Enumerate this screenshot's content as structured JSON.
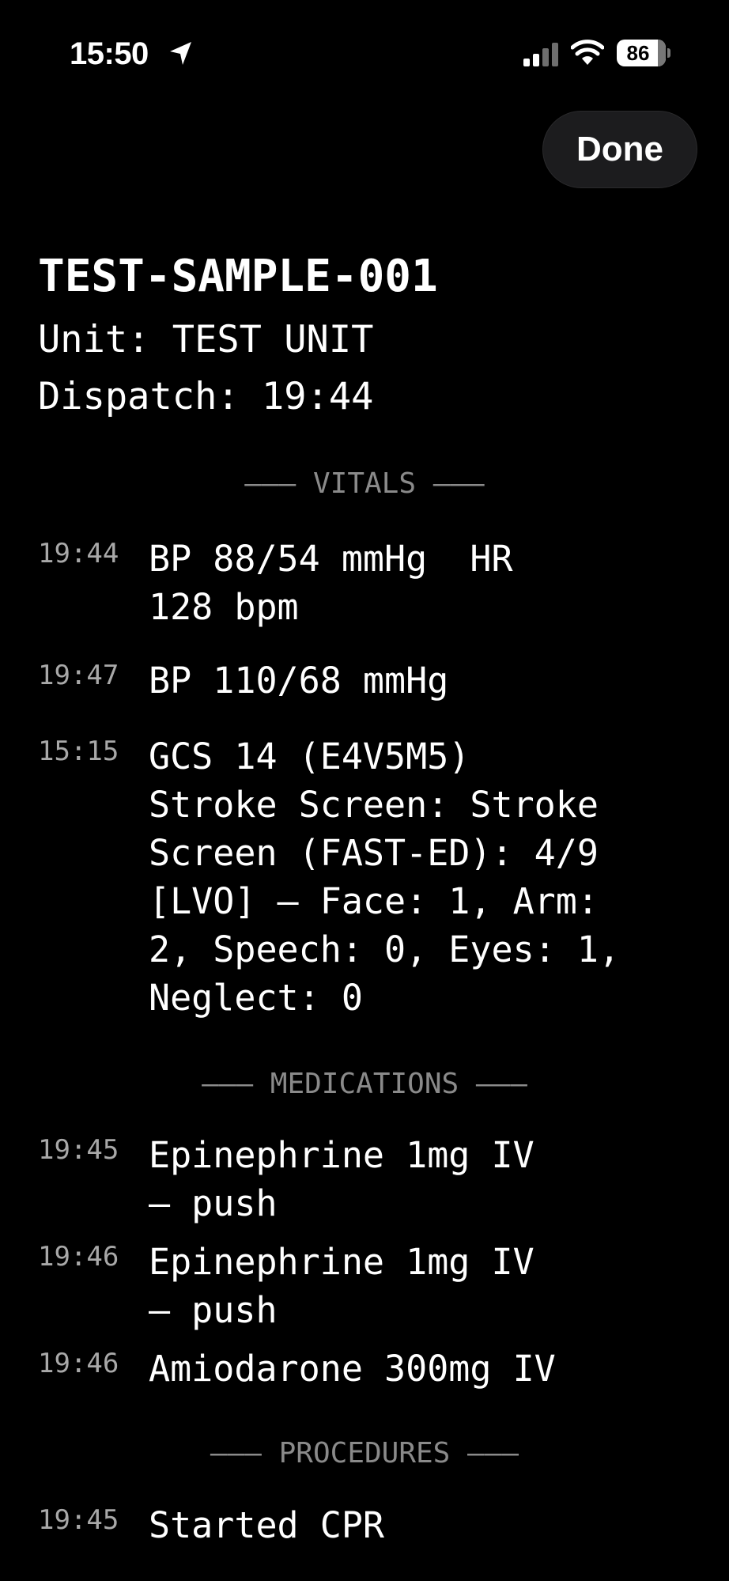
{
  "status_bar": {
    "time": "15:50",
    "battery": "86"
  },
  "header": {
    "done_label": "Done"
  },
  "record": {
    "id": "TEST-SAMPLE-001",
    "unit": "Unit: TEST UNIT",
    "dispatch": "Dispatch: 19:44"
  },
  "sections": {
    "vitals": "——— VITALS ———",
    "medications": "——— MEDICATIONS ———",
    "procedures": "——— PROCEDURES ———"
  },
  "vitals": [
    {
      "time": "19:44",
      "text": "BP 88/54 mmHg  HR\n128 bpm"
    },
    {
      "time": "19:47",
      "text": "BP 110/68 mmHg"
    },
    {
      "time": "15:15",
      "text": "GCS 14 (E4V5M5)\nStroke Screen: Stroke\nScreen (FAST-ED): 4/9\n[LVO] — Face: 1, Arm:\n2, Speech: 0, Eyes: 1,\nNeglect: 0"
    }
  ],
  "medications": [
    {
      "time": "19:45",
      "text": "Epinephrine 1mg IV\n— push"
    },
    {
      "time": "19:46",
      "text": "Epinephrine 1mg IV\n— push"
    },
    {
      "time": "19:46",
      "text": "Amiodarone 300mg IV"
    }
  ],
  "procedures": [
    {
      "time": "19:45",
      "text": "Started CPR"
    }
  ]
}
